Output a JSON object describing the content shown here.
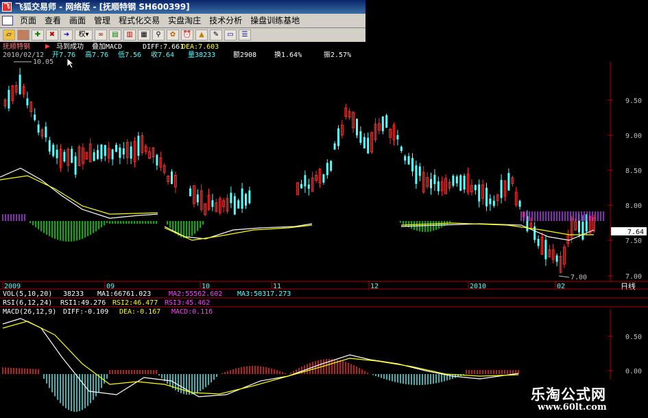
{
  "window": {
    "title": "飞狐交易师 - 网络版 - [抚顺特钢 SH600399]",
    "icon": "app-icon"
  },
  "menu": [
    "页面",
    "查看",
    "画面",
    "管理",
    "程式化交易",
    "实盘淘庄",
    "技术分析",
    "操盘训练基地"
  ],
  "toolbar": {
    "icons": [
      "open-folder-icon",
      "floppy-icon",
      "add-icon",
      "delete-icon",
      "right-icon",
      "quan-dropdown",
      "glasses-icon",
      "chart-icon",
      "bar-chart-icon",
      "document-icon",
      "search-icon",
      "palette-icon",
      "alarm-icon",
      "warning-icon",
      "pencil-icon",
      "layout-icon",
      "list-icon"
    ],
    "quan_label": "权"
  },
  "header": {
    "stock_name": "抚顺特钢",
    "signal": "马到成功",
    "overlay": "叠加MACD",
    "diff": "DIFF:7.661",
    "dea": "DEA:7.603",
    "date": "2010/02/12",
    "open": "开7.76",
    "high": "高7.76",
    "low": "低7.56",
    "close": "收7.64",
    "volume": "量38233",
    "amount": "额2908",
    "turnover": "换1.64%",
    "amplitude": "振2.57%"
  },
  "price_axis": {
    "ticks": [
      "9.50",
      "9.00",
      "8.50",
      "8.00",
      "7.50",
      "7.00"
    ],
    "current": "7.64",
    "high_mark": "10.05",
    "low_mark": "7.00"
  },
  "time_axis": {
    "labels": [
      "2009",
      "09",
      "10",
      "11",
      "12",
      "2010",
      "02"
    ],
    "period": "日线"
  },
  "vol_line": {
    "name": "VOL(5,10,20)",
    "vol": "38233",
    "ma1": "MA1:66761.023",
    "ma2": "MA2:55562.602",
    "ma3": "MA3:50317.273"
  },
  "rsi_line": {
    "name": "RSI(6,12,24)",
    "rsi1": "RSI1:49.276",
    "rsi2": "RSI2:46.477",
    "rsi3": "RSI3:45.462"
  },
  "macd_line": {
    "name": "MACD(26,12,9)",
    "diff": "DIFF:-0.109",
    "dea": "DEA:-0.167",
    "macd": "MACD:0.116"
  },
  "macd_axis": {
    "ticks": [
      "0.50",
      "0.00"
    ]
  },
  "watermark": {
    "cn": "乐淘公式网",
    "url": "www.60lt.com"
  },
  "colors": {
    "up": "#ff3030",
    "down": "#54ffff",
    "axis_red": "#b00000",
    "ma_white": "#ffffff",
    "ma_yellow": "#ffff00",
    "hist_green": "#00ff00",
    "hist_purple": "#c040ff"
  }
}
